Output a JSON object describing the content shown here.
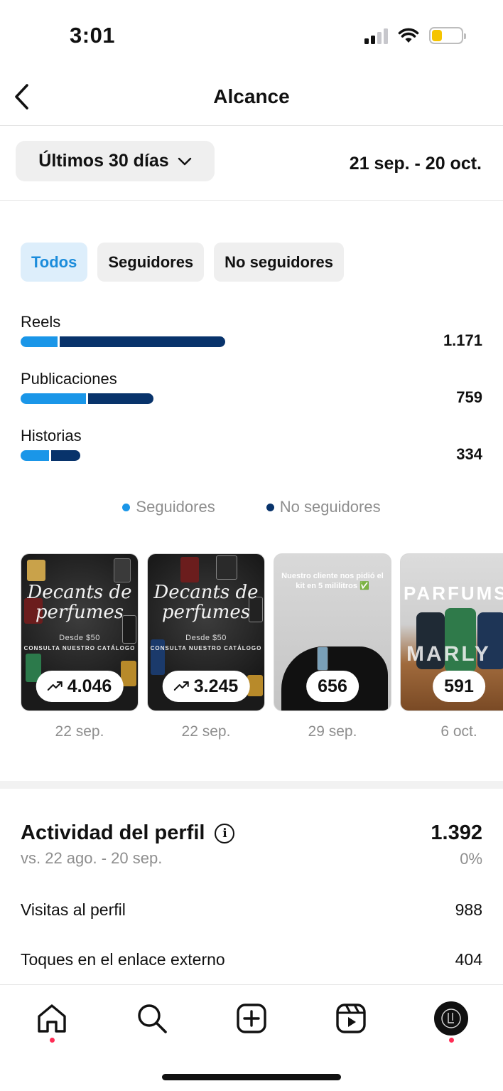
{
  "status_bar": {
    "time": "3:01"
  },
  "header": {
    "title": "Alcance"
  },
  "range": {
    "selected": "Últimos 30 días",
    "dates": "21 sep. - 20 oct."
  },
  "filters": [
    {
      "label": "Todos",
      "active": true
    },
    {
      "label": "Seguidores",
      "active": false
    },
    {
      "label": "No seguidores",
      "active": false
    }
  ],
  "breakdown": [
    {
      "label": "Reels",
      "value": "1.171",
      "followers_share": 0.18,
      "total_share": 1.0
    },
    {
      "label": "Publicaciones",
      "value": "759",
      "followers_share": 0.49,
      "total_share": 0.65
    },
    {
      "label": "Historias",
      "value": "334",
      "followers_share": 0.48,
      "total_share": 0.29
    }
  ],
  "legend": {
    "followers": "Seguidores",
    "non_followers": "No seguidores",
    "followers_color": "#1a96e8",
    "non_followers_color": "#08336b"
  },
  "posts": [
    {
      "value": "4.046",
      "trending": true,
      "date": "22 sep.",
      "title": "Decants de perfumes",
      "subtitle": "Desde $50",
      "caption": "CONSULTA NUESTRO CATÁLOGO"
    },
    {
      "value": "3.245",
      "trending": true,
      "date": "22 sep.",
      "title": "Decants de perfumes",
      "subtitle": "Desde $50",
      "caption": "CONSULTA NUESTRO CATÁLOGO"
    },
    {
      "value": "656",
      "trending": false,
      "date": "29 sep.",
      "caption": "Nuestro cliente nos pidió el kit en 5 mililitros ✅"
    },
    {
      "value": "591",
      "trending": false,
      "date": "6 oct.",
      "title": "PARFUMS",
      "subtitle": "MARLY"
    }
  ],
  "activity": {
    "title": "Actividad del perfil",
    "total": "1.392",
    "compare": "vs. 22 ago. - 20 sep.",
    "change": "0%",
    "metrics": [
      {
        "label": "Visitas al perfil",
        "value": "988"
      },
      {
        "label": "Toques en el enlace externo",
        "value": "404"
      }
    ]
  },
  "tabs": [
    "home",
    "search",
    "create",
    "reels",
    "profile"
  ]
}
